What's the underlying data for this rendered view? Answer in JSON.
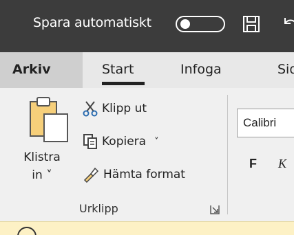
{
  "titlebar": {
    "autosave_label": "Spara automatiskt",
    "autosave_on": false,
    "save_icon": "save-icon",
    "undo_icon": "undo-icon",
    "background": "#3c3c3c"
  },
  "tabs": [
    {
      "label": "Arkiv"
    },
    {
      "label": "Start"
    },
    {
      "label": "Infoga"
    },
    {
      "label": "Sid"
    }
  ],
  "ribbon": {
    "clipboard": {
      "paste_label_line1": "Klistra",
      "paste_label_line2": "in ˅",
      "cut_label": "Klipp ut",
      "copy_label": "Kopiera",
      "copy_chevron": "˅",
      "format_label": "Hämta format",
      "group_label": "Urklipp"
    },
    "font": {
      "font_name": "Calibri",
      "bold_label": "F",
      "italic_label": "K"
    }
  },
  "infobar": {
    "background": "#fdf1c5",
    "icon": "info-icon"
  }
}
